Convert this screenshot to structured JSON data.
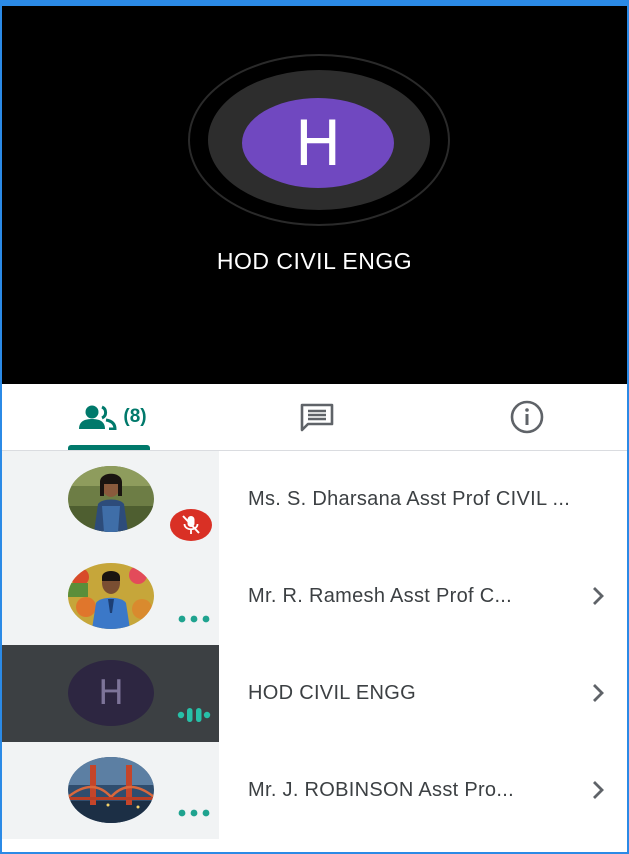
{
  "stage": {
    "initial": "H",
    "name": "HOD CIVIL ENGG",
    "avatar_color": "#7048c0"
  },
  "tabs": {
    "people_icon": "people-icon",
    "people_count": "(8)",
    "chat_icon": "chat-icon",
    "info_icon": "info-icon",
    "accent_color": "#00796b"
  },
  "participants": [
    {
      "name": "Ms. S. Dharsana Asst Prof CIVIL ...",
      "avatar": "photo",
      "status": "muted"
    },
    {
      "name": "Mr. R. Ramesh Asst Prof C...",
      "avatar": "photo",
      "status": "more-options"
    },
    {
      "name": "HOD CIVIL ENGG",
      "avatar_initial": "H",
      "status": "speaking"
    },
    {
      "name": "Mr. J. ROBINSON Asst Pro...",
      "avatar": "photo",
      "status": "more-options"
    }
  ]
}
